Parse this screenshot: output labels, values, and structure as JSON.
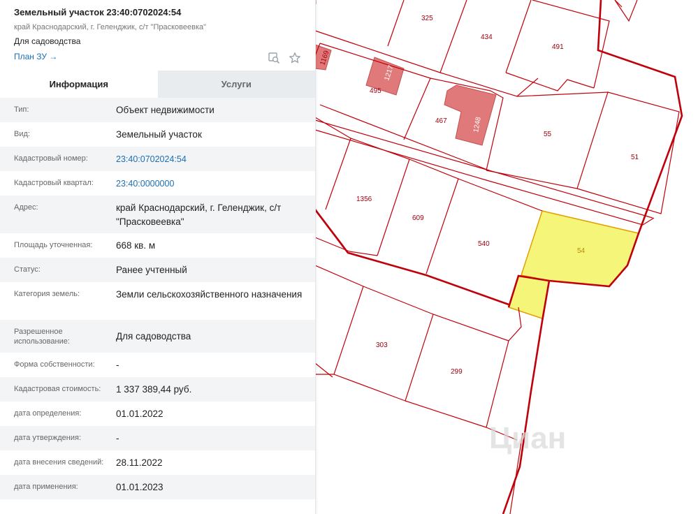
{
  "header": {
    "title": "Земельный участок 23:40:0702024:54",
    "address": "край Краснодарский, г. Геленджик, с/т \"Прасковеевка\"",
    "purpose": "Для садоводства",
    "plan_link": "План ЗУ →"
  },
  "tabs": [
    {
      "label": "Информация",
      "active": true
    },
    {
      "label": "Услуги",
      "active": false
    }
  ],
  "rows": [
    {
      "label": "Тип:",
      "value": "Объект недвижимости"
    },
    {
      "label": "Вид:",
      "value": "Земельный участок"
    },
    {
      "label": "Кадастровый номер:",
      "value": "23:40:0702024:54",
      "link": true
    },
    {
      "label": "Кадастровый квартал:",
      "value": "23:40:0000000",
      "link": true
    },
    {
      "label": "Адрес:",
      "value": "край Краснодарский, г. Геленджик, с/т \"Прасковеевка\""
    },
    {
      "label": "Площадь уточненная:",
      "value": "668 кв. м"
    },
    {
      "label": "Статус:",
      "value": "Ранее учтенный"
    },
    {
      "label": "Категория земель:",
      "value": "Земли сельскохозяйственного назначения"
    },
    {
      "label": "Разрешенное использование:",
      "value": "Для садоводства"
    },
    {
      "label": "Форма собственности:",
      "value": "-"
    },
    {
      "label": "Кадастровая стоимость:",
      "value": "1 337 389,44 руб."
    },
    {
      "label": "дата определения:",
      "value": "01.01.2022"
    },
    {
      "label": "дата утверждения:",
      "value": "-"
    },
    {
      "label": "дата внесения сведений:",
      "value": "28.11.2022"
    },
    {
      "label": "дата применения:",
      "value": "01.01.2023"
    }
  ],
  "map": {
    "parcel_labels": {
      "p325": "325",
      "p434": "434",
      "p491": "491",
      "p1169": "1169",
      "p1217": "1217",
      "p495": "495",
      "p1248": "1248",
      "p467": "467",
      "p55": "55",
      "p51": "51",
      "p1356": "1356",
      "p609": "609",
      "p540": "540",
      "p54": "54",
      "p303": "303",
      "p299": "299"
    },
    "watermark": "Циан",
    "colors": {
      "parcel_border": "#c0000a",
      "selected_fill": "#f5f57a",
      "selected_border": "#e0a000",
      "building_fill": "#e07a7a",
      "label_color": "#a00010",
      "link": "#1a6fb5"
    }
  },
  "icons": [
    "map-search-icon",
    "star-icon"
  ]
}
